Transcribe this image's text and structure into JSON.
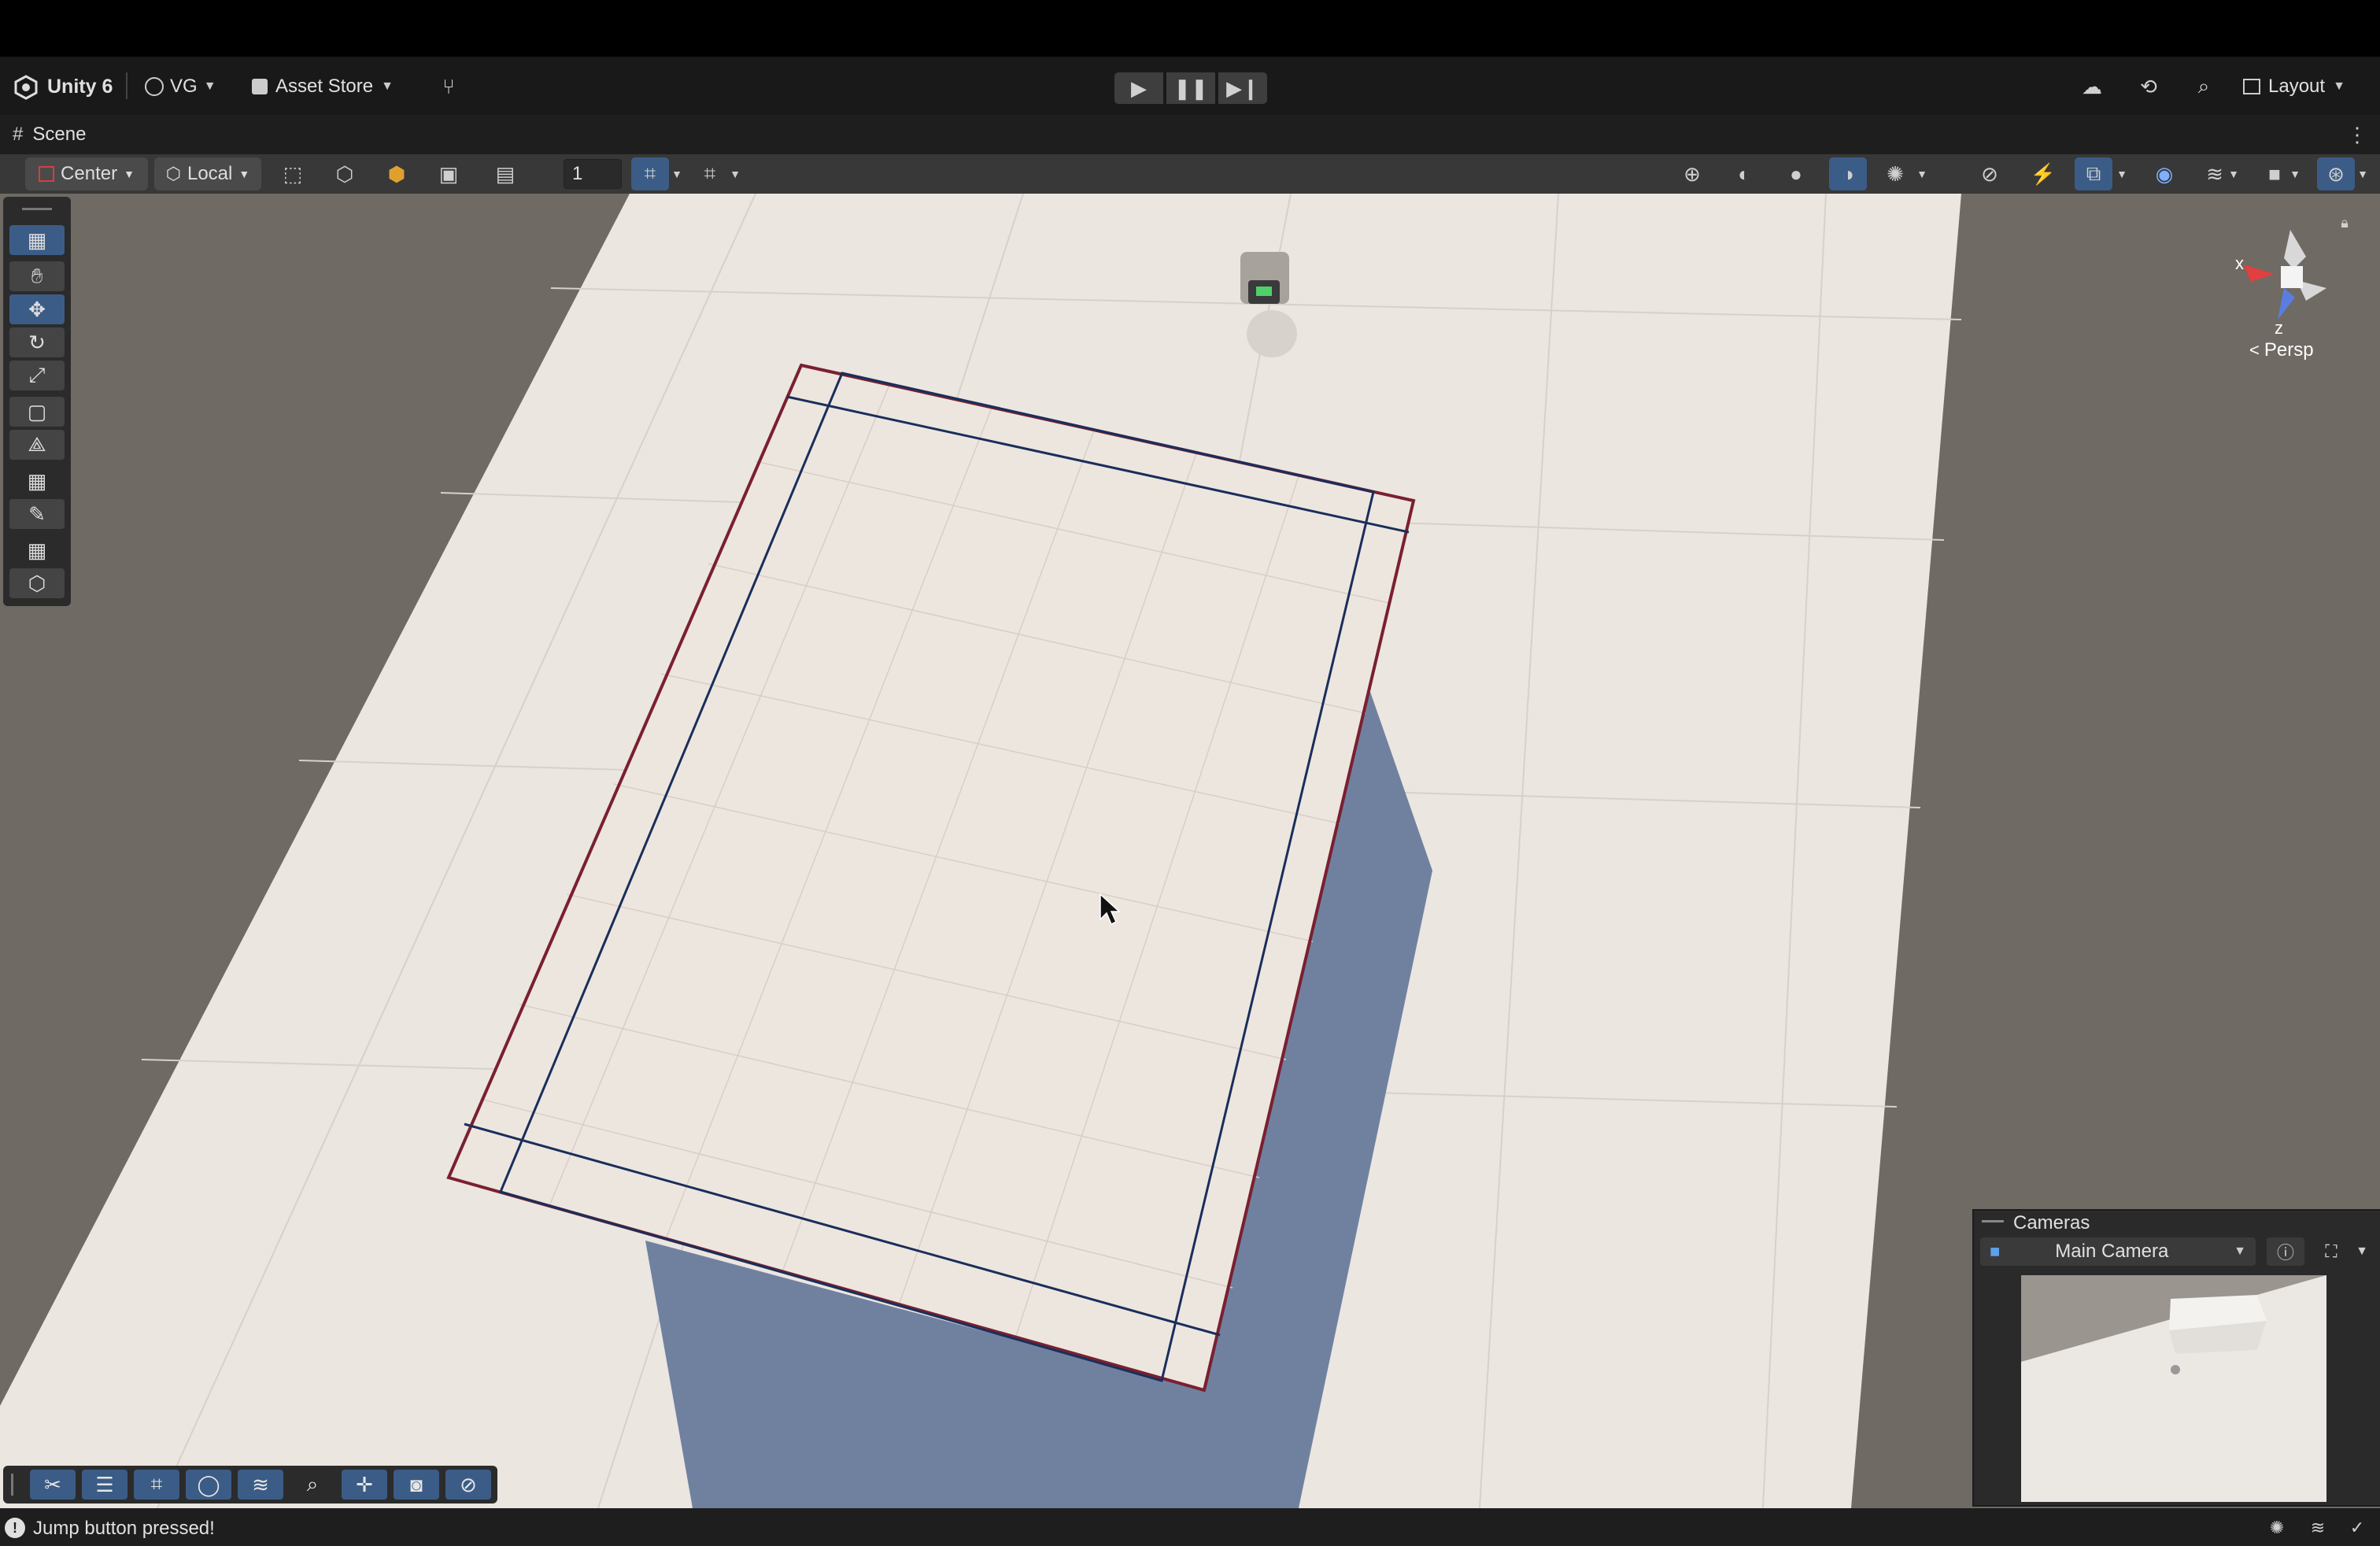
{
  "menubar": {
    "app_name": "Unity 6",
    "account": "VG",
    "asset_store": "Asset Store",
    "layout": "Layout"
  },
  "tabs": {
    "scene": "Scene"
  },
  "toolbar": {
    "pivot_mode": "Center",
    "pivot_rotation": "Local",
    "snap_increment": "1"
  },
  "gizmo": {
    "x_label": "x",
    "z_label": "z",
    "projection": "Persp"
  },
  "cameras": {
    "title": "Cameras",
    "selected": "Main Camera"
  },
  "status": {
    "message": "Jump button pressed!"
  },
  "colors": {
    "accent": "#3b5c86",
    "ground": "#ebe6e0",
    "shadow": "#7081a0",
    "outline_red": "#7a2030",
    "outline_blue": "#1a2e5a"
  }
}
